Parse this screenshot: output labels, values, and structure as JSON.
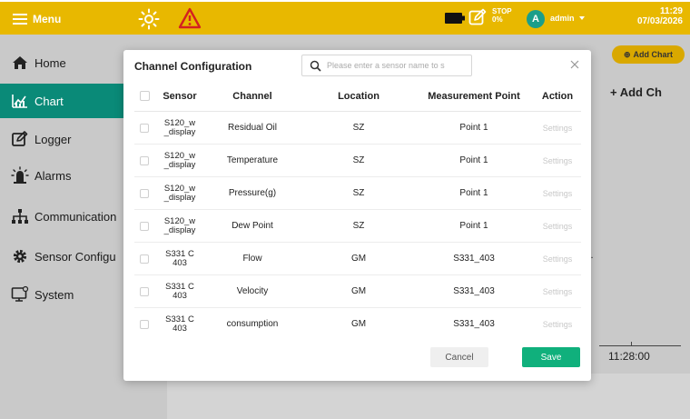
{
  "topbar": {
    "menu_label": "Menu",
    "stop_label": "STOP",
    "stop_percent": "0%",
    "avatar_initial": "A",
    "user_name": "admin",
    "time": "11:29",
    "date": "07/03/2026",
    "bar_color": "#e8b800",
    "icons": [
      "hamburger-icon",
      "sun-icon",
      "warning-icon",
      "battery-icon",
      "edit-icon",
      "caret-down-icon"
    ]
  },
  "sidebar": {
    "active_color": "#0a8a78",
    "items": [
      {
        "label": "Home",
        "icon": "home-icon"
      },
      {
        "label": "Chart",
        "icon": "chart-icon",
        "active": true
      },
      {
        "label": "Logger",
        "icon": "logger-icon"
      },
      {
        "label": "Alarms",
        "icon": "alarm-icon"
      },
      {
        "label": "Communication",
        "icon": "network-icon"
      },
      {
        "label": "Sensor Configu",
        "icon": "gear-icon"
      },
      {
        "label": "System",
        "icon": "monitor-icon"
      }
    ]
  },
  "background": {
    "add_chart_button": "Add Chart",
    "add_chart_tab": "+ Add Ch",
    "next_arrow": ">",
    "partial_text": "el.",
    "axis_time": "11:28:00"
  },
  "modal": {
    "title": "Channel Configuration",
    "search_placeholder": "Please enter a sensor name to s",
    "columns": {
      "sensor": "Sensor",
      "channel": "Channel",
      "location": "Location",
      "measurement_point": "Measurement Point",
      "action": "Action"
    },
    "rows": [
      {
        "sensor": "S120_w _display",
        "channel": "Residual Oil",
        "location": "SZ",
        "mp": "Point 1",
        "action": "Settings"
      },
      {
        "sensor": "S120_w _display",
        "channel": "Temperature",
        "location": "SZ",
        "mp": "Point 1",
        "action": "Settings"
      },
      {
        "sensor": "S120_w _display",
        "channel": "Pressure(g)",
        "location": "SZ",
        "mp": "Point 1",
        "action": "Settings"
      },
      {
        "sensor": "S120_w _display",
        "channel": "Dew Point",
        "location": "SZ",
        "mp": "Point 1",
        "action": "Settings"
      },
      {
        "sensor": "S331 C 403",
        "channel": "Flow",
        "location": "GM",
        "mp": "S331_403",
        "action": "Settings"
      },
      {
        "sensor": "S331 C 403",
        "channel": "Velocity",
        "location": "GM",
        "mp": "S331_403",
        "action": "Settings"
      },
      {
        "sensor": "S331 C 403",
        "channel": "consumption",
        "location": "GM",
        "mp": "S331_403",
        "action": "Settings"
      }
    ],
    "cancel_label": "Cancel",
    "save_label": "Save",
    "save_color": "#10b07c"
  }
}
